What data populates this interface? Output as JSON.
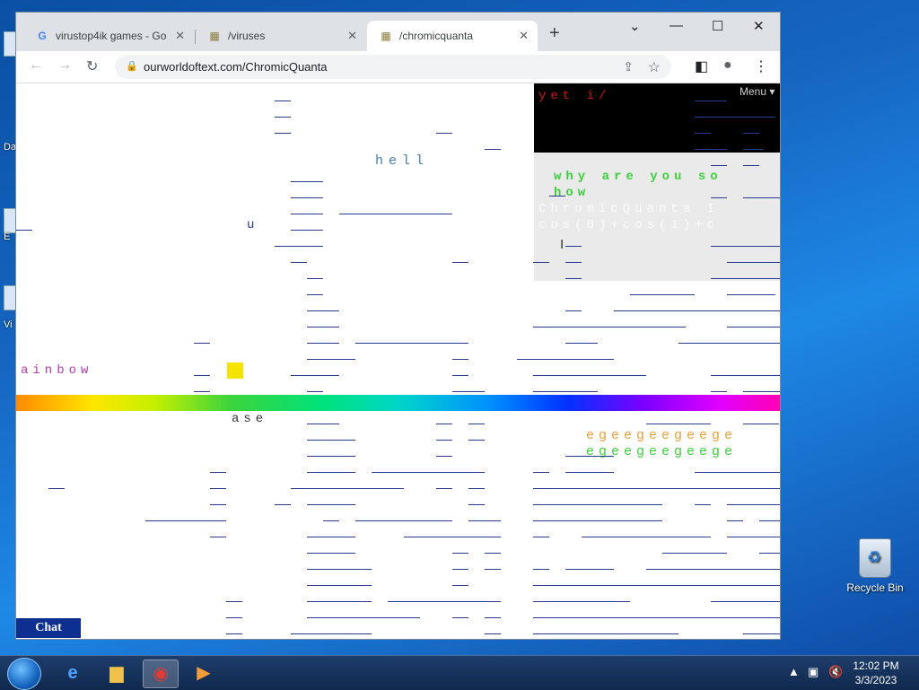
{
  "desktop": {
    "left_fragments": [
      "Da",
      "E",
      "Vi"
    ],
    "recycle_bin_label": "Recycle Bin"
  },
  "browser": {
    "tabs": [
      {
        "title": "virustop4ik games - Go",
        "favicon": "google-icon",
        "active": false
      },
      {
        "title": "/viruses",
        "favicon": "ourworldoftext-icon",
        "active": false
      },
      {
        "title": "/chromicquanta",
        "favicon": "ourworldoftext-icon",
        "active": true
      }
    ],
    "new_tab": "+",
    "url": "ourworldoftext.com/ChromicQuanta"
  },
  "page": {
    "menu_label": "Menu",
    "texts": {
      "yet": "yet i/",
      "hell": "hell",
      "u": "u",
      "why": "why are you so",
      "how": "how",
      "chromic": "ChromicQuanta I",
      "cos": "cos(0)+cos(1)+c",
      "rainbow": "ainbow",
      "ase": "ase",
      "e1": "egeegeegeege",
      "e2": "egeegeegeege"
    },
    "chat_label": "Chat"
  },
  "taskbar": {
    "clock_time": "12:02 PM",
    "clock_date": "3/3/2023"
  },
  "colors": {
    "accent_blue": "#1565c0",
    "underline": "#2a3a8f",
    "green_text": "#3ecf3e",
    "red_text": "#d01818"
  }
}
